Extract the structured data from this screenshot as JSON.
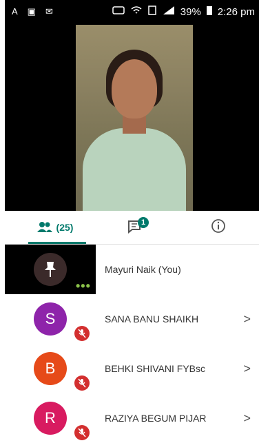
{
  "status_bar": {
    "battery": "39%",
    "time": "2:26 pm",
    "left_icons": [
      "A",
      "▣",
      "✉"
    ],
    "right_icons": [
      "mute-vibrate-icon",
      "wifi-icon",
      "sim-icon",
      "signal-icon",
      "battery-icon"
    ]
  },
  "tabs": {
    "people_count": "(25)",
    "chat_badge": "1"
  },
  "participants": [
    {
      "name": "Mayuri Naik (You)",
      "initial": "",
      "color": "#3b2a2a",
      "muted": false
    },
    {
      "name": "SANA BANU SHAIKH",
      "initial": "S",
      "color": "#8e24aa",
      "muted": true
    },
    {
      "name": "BEHKI SHIVANI FYBsc",
      "initial": "B",
      "color": "#e64a19",
      "muted": true
    },
    {
      "name": "RAZIYA BEGUM PIJAR",
      "initial": "R",
      "color": "#d81b60",
      "muted": true
    }
  ],
  "colors": {
    "accent": "#00796b",
    "mute_red": "#d32f2f"
  }
}
